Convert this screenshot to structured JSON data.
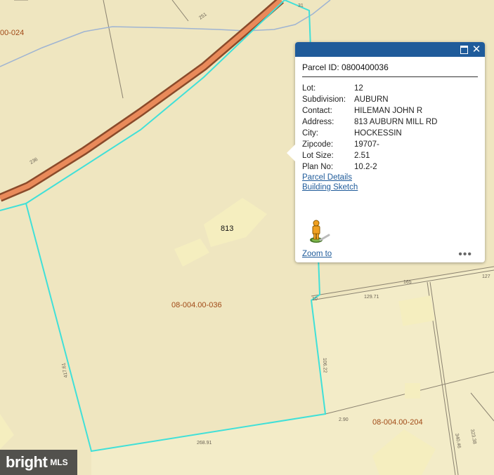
{
  "map": {
    "colors": {
      "background": "#efe6c0",
      "parcel_fill": "#ebddb0",
      "neighbor_fill": "#f3ecc8",
      "parcel_outline": "#40e0d8",
      "road_outer": "#8a4a2a",
      "road_inner": "#e98a5a",
      "stream": "#9fb4d2",
      "building": "#f5eebf",
      "parcel_line": "#8a8270"
    },
    "parcel_labels": {
      "top_left": "00-024",
      "main": "08-004.00-036",
      "neighbor": "08-004.00-204"
    },
    "house_number": "813",
    "dimension_labels": {
      "road_top": "251",
      "corner_top": "31",
      "road_left": "236",
      "right_top": "165",
      "right_far": "127",
      "right_edge_a": "129.71",
      "corner_right": "10",
      "east_side": "106.22",
      "west_side": "417.61",
      "south_side": "268.91",
      "corner_south": "2.90",
      "far_right_a": "340.46",
      "far_right_b": "323.38"
    }
  },
  "popup": {
    "title": "Parcel ID: 0800400036",
    "fields": [
      {
        "key": "Lot:",
        "value": "12"
      },
      {
        "key": "Subdivision:",
        "value": "AUBURN"
      },
      {
        "key": "Contact:",
        "value": "HILEMAN JOHN R"
      },
      {
        "key": "Address:",
        "value": "813 AUBURN MILL RD"
      },
      {
        "key": "City:",
        "value": "HOCKESSIN"
      },
      {
        "key": "Zipcode:",
        "value": "19707-"
      },
      {
        "key": "Lot Size:",
        "value": "2.51"
      },
      {
        "key": "Plan No:",
        "value": "10.2-2"
      }
    ],
    "links": {
      "parcel_details": "Parcel Details",
      "building_sketch": "Building Sketch",
      "zoom_to": "Zoom to"
    },
    "icons": {
      "maximize": "maximize-icon",
      "close": "close-icon",
      "street_view": "pegman-icon",
      "more": "more-icon"
    },
    "colors": {
      "titlebar": "#1f5b9a",
      "link": "#1f5b9a"
    }
  },
  "watermark": {
    "brand": "bright",
    "suffix": "MLS"
  }
}
